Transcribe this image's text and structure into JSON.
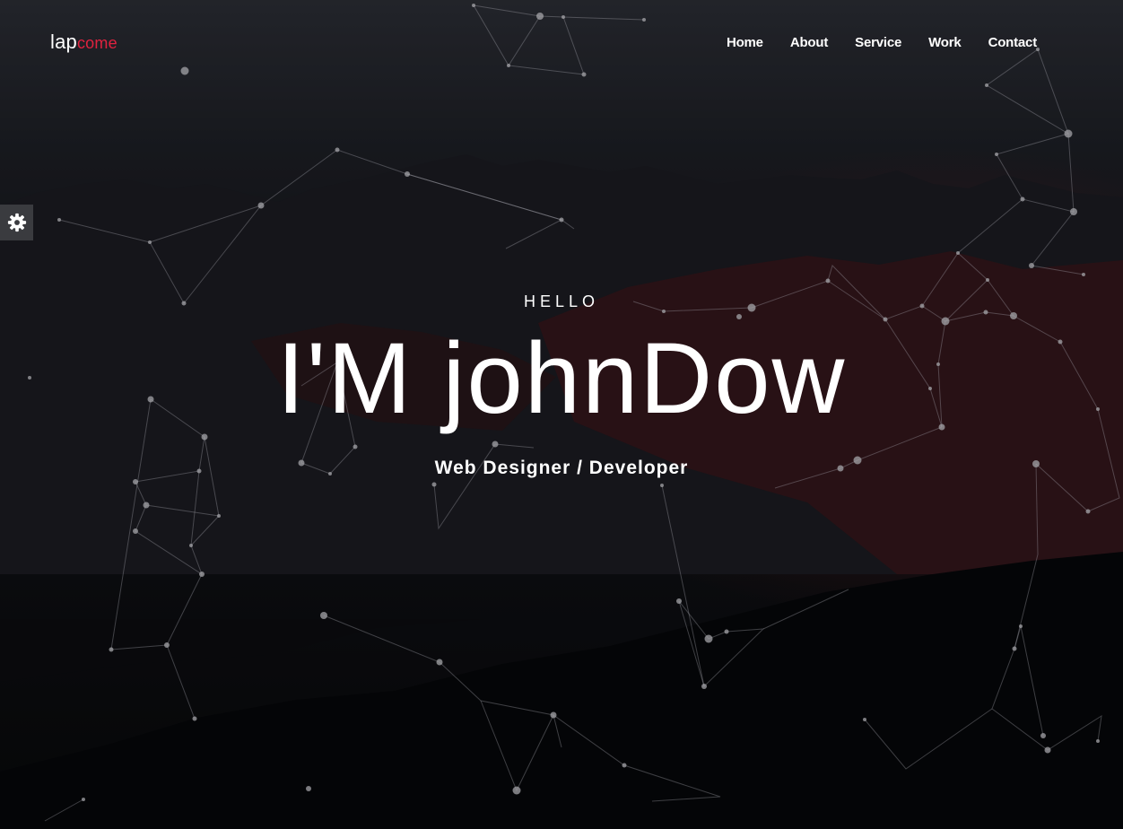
{
  "header": {
    "logo_main": "lap",
    "logo_accent": "come",
    "nav": [
      "Home",
      "About",
      "Service",
      "Work",
      "Contact"
    ]
  },
  "hero": {
    "greeting": "HELLO",
    "name": "I'M johnDow",
    "role": "Web Designer / Developer"
  },
  "settings": {
    "icon": "gear-icon"
  },
  "colors": {
    "accent": "#e0223f",
    "text": "#ffffff",
    "settings_tab": "#3a3b3f",
    "background": "#0b0c10"
  }
}
